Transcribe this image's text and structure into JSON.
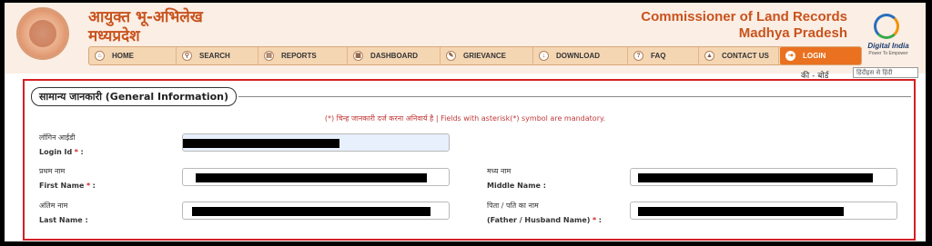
{
  "header": {
    "title_hi_line1": "आयुक्त भू-अभिलेख",
    "title_hi_line2": "मध्यप्रदेश",
    "title_en_line1": "Commissioner of Land Records",
    "title_en_line2": "Madhya Pradesh",
    "digital_india": "Digital India",
    "digital_india_tagline": "Power To Empower"
  },
  "nav": [
    {
      "label": "HOME",
      "icon": "home-icon"
    },
    {
      "label": "SEARCH",
      "icon": "search-icon"
    },
    {
      "label": "REPORTS",
      "icon": "reports-icon"
    },
    {
      "label": "DASHBOARD",
      "icon": "dashboard-icon"
    },
    {
      "label": "GRIEVANCE",
      "icon": "grievance-icon"
    },
    {
      "label": "DOWNLOAD",
      "icon": "download-icon"
    },
    {
      "label": "FAQ",
      "icon": "faq-icon"
    },
    {
      "label": "CONTACT US",
      "icon": "contact-icon"
    },
    {
      "label": "LOGIN",
      "icon": "login-icon"
    }
  ],
  "keyboard": {
    "label": "की - बोर्ड",
    "select_value": "हिंदीइस से हिंदी"
  },
  "section": {
    "title": "सामान्य जानकारी (General Information)",
    "mandatory_note": "(*) चिन्ह जानकारी दर्ज करना अनिवार्य है | Fields with asterisk(*) symbol are mandatory."
  },
  "fields": {
    "login_id": {
      "label_hi": "लॉगिन आईडी",
      "label_en": "Login Id"
    },
    "first_name": {
      "label_hi": "प्रथम नाम",
      "label_en": "First Name"
    },
    "middle_name": {
      "label_hi": "मध्य नाम",
      "label_en": "Middle Name :"
    },
    "last_name": {
      "label_hi": "अंतिम नाम",
      "label_en": "Last Name :"
    },
    "father_husband_name": {
      "label_hi": "पिता / पति का नाम",
      "label_en": "(Father / Husband Name)"
    }
  },
  "colors": {
    "brand_orange": "#c8531e",
    "header_bg": "#fbeee4",
    "nav_bg": "#f5d6b3",
    "login_bg": "#e9711f",
    "highlight_red": "#d41f26"
  }
}
